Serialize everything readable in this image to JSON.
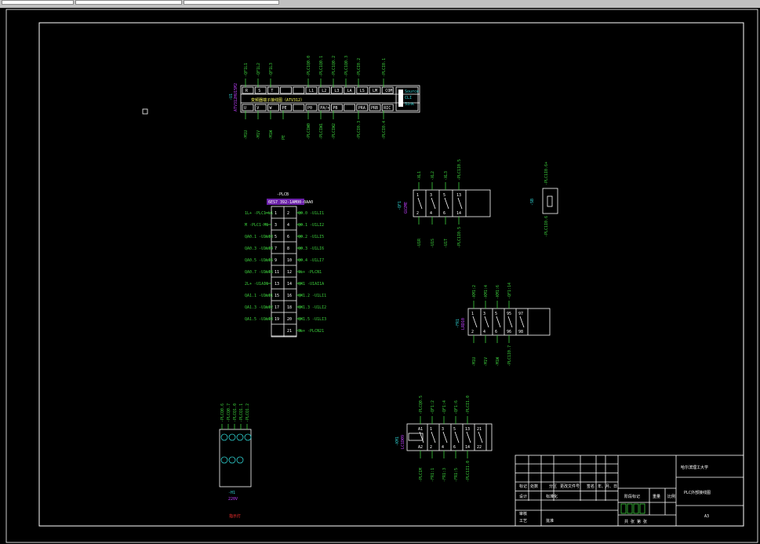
{
  "window": {
    "tabs": [
      "",
      "",
      ""
    ]
  },
  "drive": {
    "title": "-U1",
    "subtitle": "ATV312HU15M2",
    "top_terminals": [
      "R",
      "S",
      "T",
      "",
      "",
      "L1",
      "L2",
      "L3",
      "LA",
      "LS",
      "LM",
      "COM"
    ],
    "bottom_terminals": [
      "U",
      "V",
      "W",
      "PE",
      "",
      "P0",
      "PA/+",
      "PB",
      "",
      "PRA",
      "PRB",
      "RIC"
    ],
    "middle_text": "变频器端子接线图（ATV312）",
    "source_switch": [
      "Source",
      "CLI",
      "Sink"
    ],
    "top_wires": [
      "-QF1L1",
      "-QF1L2",
      "-QF1L3",
      "-PLC1Q0.0",
      "-PLC1Q0.1",
      "-PLC1Q0.2",
      "-PLC1Q0.3",
      "-PLCI0.2",
      "-PLCI0.1"
    ],
    "bottom_wires": [
      "-M1U",
      "-M1V",
      "-M1W",
      "PE",
      "-PLCIW0",
      "-PLCIW1",
      "-PLCIW2",
      "-PLCI0.3",
      "-PLCI0.4"
    ]
  },
  "plc_connector": {
    "title": "-PLCB",
    "part": "6ES7 392-1AM00-0AA0",
    "rows": [
      {
        "l": "1",
        "r": "2",
        "left_wire": "1L+ -PLC1-L1",
        "right_wire": "Q0.0 -U1LI1"
      },
      {
        "l": "3",
        "r": "4",
        "left_wire": "M -PLC1-M1",
        "right_wire": "Q0.1 -U1LI2"
      },
      {
        "l": "5",
        "r": "6",
        "left_wire": "QA0.1 -U1LI3",
        "right_wire": "Q0.2 -U1LI5"
      },
      {
        "l": "7",
        "r": "8",
        "left_wire": "QA0.3 -U1LI4",
        "right_wire": "Q0.3 -U1LI6"
      },
      {
        "l": "9",
        "r": "10",
        "left_wire": "QA0.5 -U1LI5",
        "right_wire": "Q0.4 -U1LI7"
      },
      {
        "l": "11",
        "r": "12",
        "left_wire": "QA0.7 -U1LI6",
        "right_wire": "1L+ -PLCN1"
      },
      {
        "l": "13",
        "r": "14",
        "left_wire": "2L+ -U1AI1",
        "right_wire": "QX1 -U1AI1A"
      },
      {
        "l": "15",
        "r": "16",
        "left_wire": "QA1.1 -U1LI1",
        "right_wire": "QX1.2 -U1LI1"
      },
      {
        "l": "17",
        "r": "18",
        "left_wire": "QA1.3 -U1LI2",
        "right_wire": "QX1.3 -U1LI2"
      },
      {
        "l": "19",
        "r": "20",
        "left_wire": "QA1.5 -U1LI3",
        "right_wire": "QX1.5 -U1LI3"
      },
      {
        "l": "",
        "r": "21",
        "left_wire": "",
        "right_wire": "3L+ -PLCN21"
      }
    ]
  },
  "qf1": {
    "title": "-QF1",
    "subtitle": "GV2ME",
    "poles": [
      "1",
      "3",
      "5",
      "13"
    ],
    "poles_bottom": [
      "2",
      "4",
      "6",
      "14"
    ],
    "top_wires": [
      "-XL1",
      "-XL2",
      "-XL3",
      "-PLC1I0.5"
    ],
    "bottom_wires": [
      "-U1R",
      "-U1S",
      "-U1T",
      "-PLC1I0.5"
    ]
  },
  "sb": {
    "title": "-SB",
    "top_wire": "-PLC1I0.6+",
    "bottom_wire": "-PLC1I0.6"
  },
  "fr": {
    "title": "-FR1",
    "subtitle": "LRD10",
    "poles": [
      "1",
      "3",
      "5",
      "95",
      "97"
    ],
    "poles_bottom": [
      "2",
      "4",
      "6",
      "96",
      "98"
    ],
    "top_wires": [
      "-KM1:2",
      "-KM1:4",
      "-KM1:6",
      "-QF1:14"
    ],
    "bottom_wires": [
      "-M1U",
      "-M1V",
      "-M1W",
      "-PLC1I0.7"
    ]
  },
  "km": {
    "title": "-KM1",
    "subtitle": "LC1D09",
    "poles": [
      "A1",
      "1",
      "3",
      "5",
      "13",
      "21"
    ],
    "poles_bottom": [
      "A2",
      "2",
      "4",
      "6",
      "14",
      "22"
    ],
    "top_wires": [
      "-PLCQ0.5",
      "-QF1:2",
      "-QF1:4",
      "-QF1:6",
      "-PLCI1.0"
    ],
    "bottom_wires": [
      "-PLC1M",
      "-FR1:1",
      "-FR1:3",
      "-FR1:5",
      "-PLC1I1.0"
    ]
  },
  "lamp": {
    "title": "-H1",
    "voltage": "220V",
    "wires": [
      "-PLCQ0.6",
      "-PLCQ0.7",
      "-PLCQ1.0",
      "-PLCQ1.1",
      "-PLCQ1.2"
    ],
    "label_red": "指示灯"
  },
  "title_block": {
    "company": "哈尔滨理工大学",
    "drawing_name": "PLC外部接线图",
    "scale": "比例",
    "stage": "阶段标记",
    "weight": "重量",
    "sheet": "共 张  第 张",
    "drawing_no": "A3",
    "row_labels": [
      "标记",
      "处数",
      "分区",
      "更改文件号",
      "签名",
      "年、月、日"
    ],
    "design": "设计",
    "standardize": "标准化",
    "review": "审核",
    "process": "工艺",
    "approve": "批准"
  }
}
